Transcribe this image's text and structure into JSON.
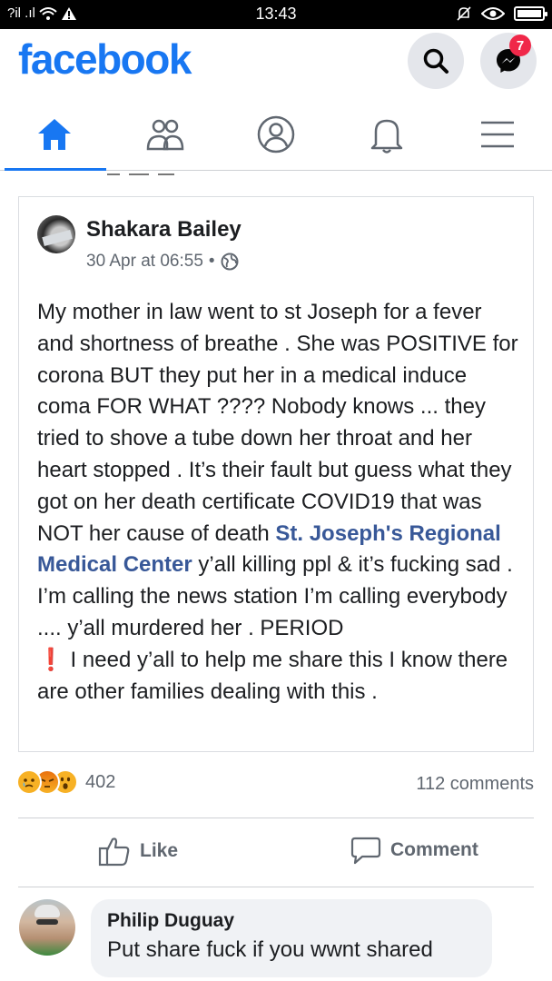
{
  "status_bar": {
    "left_text": "?il .ıl",
    "time": "13:43"
  },
  "header": {
    "logo": "facebook",
    "messenger_badge": "7"
  },
  "tabs": [
    {
      "name": "home",
      "icon": "home-icon",
      "active": true
    },
    {
      "name": "friends",
      "icon": "friends-icon",
      "active": false
    },
    {
      "name": "profile",
      "icon": "profile-icon",
      "active": false
    },
    {
      "name": "notifications",
      "icon": "bell-icon",
      "active": false
    },
    {
      "name": "menu",
      "icon": "menu-icon",
      "active": false
    }
  ],
  "post": {
    "author": "Shakara Bailey",
    "date": "30 Apr at 06:55",
    "separator": "•",
    "privacy_icon": "globe-icon",
    "text_part1": "My mother in law went to st Joseph for a fever and shortness of breathe . She was POSITIVE for corona BUT they put her in a medical induce coma FOR WHAT ???? Nobody knows ... they tried to shove a tube down her throat and her heart stopped . It’s their fault but guess what they got on her death certificate COVID19 that was NOT her cause of death ",
    "link_text": "St. Joseph's Regional Medical Center",
    "text_part2": " y’all killing ppl & it’s fucking sad . I’m calling the news station I’m calling everybody .... y’all murdered her . PERIOD",
    "exclamation": "❗",
    "text_part3": " I need y’all to help me share this I know there are other families dealing with this ."
  },
  "reactions": {
    "types": [
      "sad",
      "angry",
      "wow"
    ],
    "count": "402",
    "comments": "112 comments"
  },
  "actions": {
    "like": "Like",
    "comment": "Comment"
  },
  "comment": {
    "author": "Philip Duguay",
    "text": "Put share fuck if you wwnt shared"
  },
  "colors": {
    "brand": "#1877f2",
    "link": "#385898",
    "badge": "#f02849"
  }
}
